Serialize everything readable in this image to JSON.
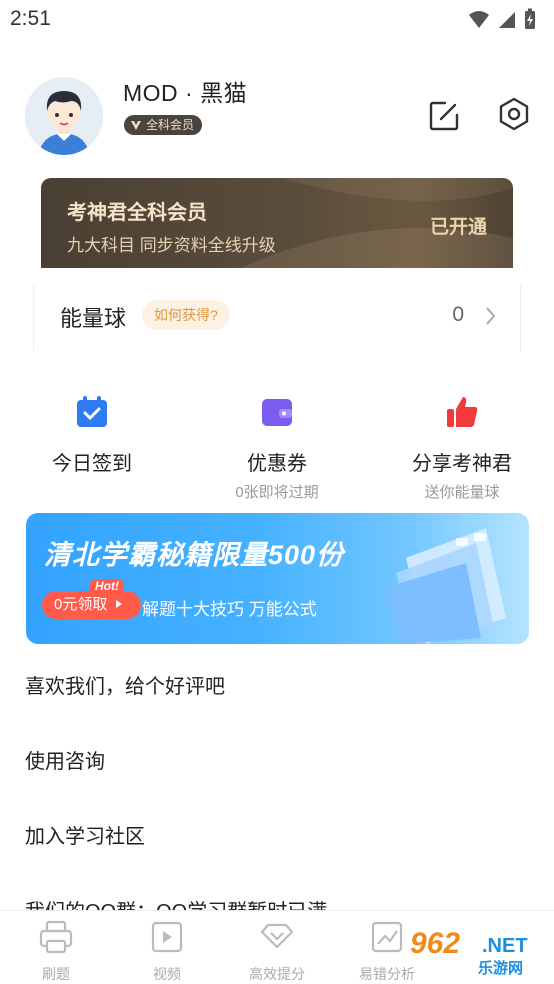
{
  "status_bar": {
    "time": "2:51"
  },
  "profile": {
    "username": "MOD · 黑猫",
    "badge": "全科会员"
  },
  "vip_card": {
    "title": "考神君全科会员",
    "subtitle": "九大科目 同步资料全线升级",
    "status": "已开通"
  },
  "energy": {
    "label": "能量球",
    "help_tag": "如何获得?",
    "value": "0"
  },
  "quick_actions": [
    {
      "label": "今日签到",
      "sub": "",
      "icon": "calendar-check-icon",
      "color": "#2f7bf5"
    },
    {
      "label": "优惠券",
      "sub": "0张即将过期",
      "icon": "wallet-icon",
      "color": "#7a5cf0"
    },
    {
      "label": "分享考神君",
      "sub": "送你能量球",
      "icon": "thumbs-up-icon",
      "color": "#ef3b3b"
    }
  ],
  "banner": {
    "title": "清北学霸秘籍限量500份",
    "hot": "Hot!",
    "button": "0元领取",
    "subtitle": "解题十大技巧 万能公式"
  },
  "menu": [
    "喜欢我们，给个好评吧",
    "使用咨询",
    "加入学习社区",
    "我们的QQ群：QQ学习群暂时已满"
  ],
  "tabbar": [
    {
      "label": "刷题",
      "icon": "printer-icon"
    },
    {
      "label": "视频",
      "icon": "video-icon"
    },
    {
      "label": "高效提分",
      "icon": "diamond-icon"
    },
    {
      "label": "易错分析",
      "icon": "chart-icon"
    }
  ],
  "watermark": {
    "num": "962",
    "net": ".NET",
    "cn": "乐游网"
  },
  "colors": {
    "vip_gold": "#f5e4c8",
    "accent_orange": "#e0963f",
    "banner_blue": "#33a3ff"
  }
}
